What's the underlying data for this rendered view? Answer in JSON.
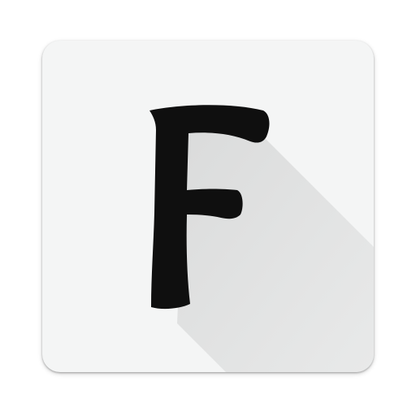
{
  "icon": {
    "letter": "F",
    "background_color": "#f4f5f5",
    "letter_color": "#0f0f0f",
    "long_shadow_color": "#dcdddd"
  }
}
